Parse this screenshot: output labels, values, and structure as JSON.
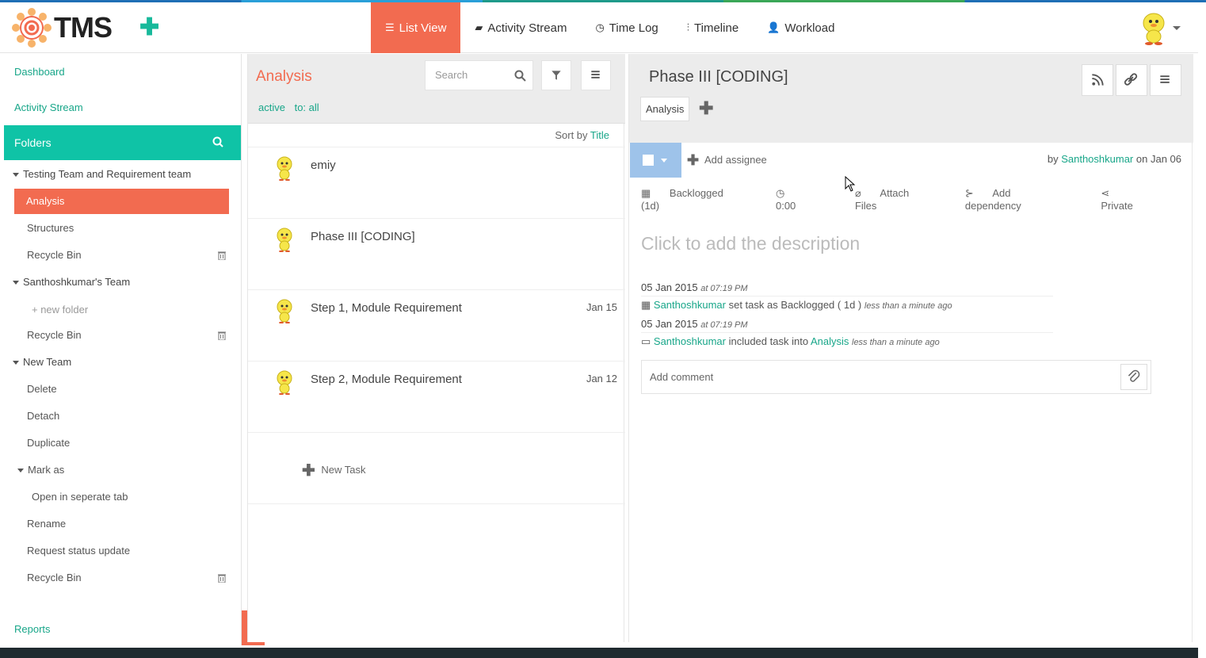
{
  "app": {
    "logo_text": "TMS"
  },
  "nav": {
    "items": [
      {
        "label": "List View",
        "icon": "list-icon",
        "active": true
      },
      {
        "label": "Activity Stream",
        "icon": "comment-icon"
      },
      {
        "label": "Time Log",
        "icon": "clock-icon"
      },
      {
        "label": "Timeline",
        "icon": "sliders-icon"
      },
      {
        "label": "Workload",
        "icon": "user-icon"
      }
    ]
  },
  "sidebar": {
    "dashboard": "Dashboard",
    "activity_stream": "Activity Stream",
    "folders_label": "Folders",
    "reports": "Reports",
    "tree": [
      {
        "label": "Testing Team and Requirement team",
        "type": "team"
      },
      {
        "label": "Analysis",
        "type": "folder",
        "active": true
      },
      {
        "label": "Structures",
        "type": "folder"
      },
      {
        "label": "Recycle Bin",
        "type": "bin"
      },
      {
        "label": "Santhoshkumar's Team",
        "type": "team"
      },
      {
        "label": "+ new folder",
        "type": "new"
      },
      {
        "label": "Recycle Bin",
        "type": "bin"
      },
      {
        "label": "New Team",
        "type": "team"
      },
      {
        "label": "Delete",
        "type": "folder"
      },
      {
        "label": "Detach",
        "type": "folder"
      },
      {
        "label": "Duplicate",
        "type": "folder"
      },
      {
        "label": "Mark as",
        "type": "subteam"
      },
      {
        "label": "Open in seperate tab",
        "type": "subfolder"
      },
      {
        "label": "Rename",
        "type": "folder"
      },
      {
        "label": "Request status update",
        "type": "folder"
      },
      {
        "label": "Recycle Bin",
        "type": "bin"
      }
    ]
  },
  "list": {
    "title": "Analysis",
    "search_placeholder": "Search",
    "filters": [
      "active",
      "to: all"
    ],
    "sort_prefix": "Sort by",
    "sort_field": "Title",
    "tasks": [
      {
        "name": "emiy",
        "date": ""
      },
      {
        "name": "Phase III [CODING]",
        "date": ""
      },
      {
        "name": "Step 1, Module Requirement",
        "date": "Jan 15"
      },
      {
        "name": "Step 2, Module Requirement",
        "date": "Jan 12"
      }
    ],
    "new_task": "New Task"
  },
  "detail": {
    "title": "Phase III [CODING]",
    "tag": "Analysis",
    "add_assignee": "Add assignee",
    "by_prefix": "by",
    "by_user": "Santhoshkumar",
    "by_date": "on Jan 06",
    "meta": {
      "status": "Backlogged (1d)",
      "time": "0:00",
      "attach": "Attach Files",
      "dependency": "Add dependency",
      "privacy": "Private"
    },
    "description_placeholder": "Click to add the description",
    "history": [
      {
        "date": "05 Jan 2015",
        "time": "at 07:19 PM",
        "user": "Santhoshkumar",
        "text": "set task as Backlogged ( 1d )",
        "link": "",
        "ago": "less than a minute ago"
      },
      {
        "date": "05 Jan 2015",
        "time": "at 07:19 PM",
        "user": "Santhoshkumar",
        "text": "included task into",
        "link": "Analysis",
        "ago": "less than a minute ago"
      }
    ],
    "comment_placeholder": "Add comment"
  },
  "colors": {
    "accent": "#f26b50",
    "teal": "#0fc3a6",
    "link": "#18a689"
  }
}
